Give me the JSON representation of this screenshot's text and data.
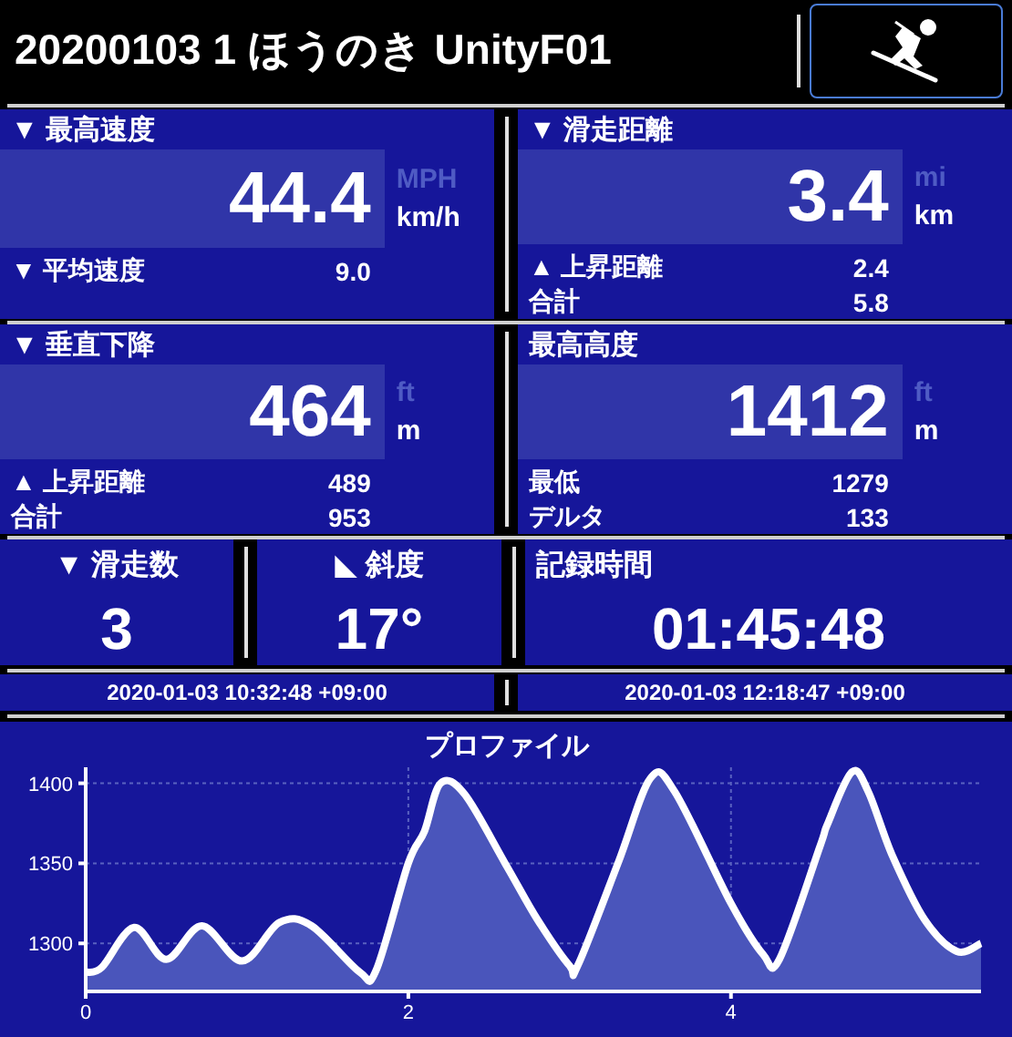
{
  "header": {
    "title": "20200103 1 ほうのき UnityF01"
  },
  "panels": [
    {
      "label": "▼ 最高速度",
      "value": "44.4",
      "units": [
        {
          "label": "MPH",
          "selected": false
        },
        {
          "label": "km/h",
          "selected": true
        }
      ],
      "rows": [
        {
          "label": "▼ 平均速度",
          "value": "9.0"
        }
      ]
    },
    {
      "label": "▼ 滑走距離",
      "value": "3.4",
      "units": [
        {
          "label": "mi",
          "selected": false
        },
        {
          "label": "km",
          "selected": true
        }
      ],
      "rows": [
        {
          "label": "▲ 上昇距離",
          "value": "2.4"
        },
        {
          "label": "合計",
          "value": "5.8"
        }
      ]
    },
    {
      "label": "▼ 垂直下降",
      "value": "464",
      "units": [
        {
          "label": "ft",
          "selected": false
        },
        {
          "label": "m",
          "selected": true
        }
      ],
      "rows": [
        {
          "label": "▲ 上昇距離",
          "value": "489"
        },
        {
          "label": "合計",
          "value": "953"
        }
      ]
    },
    {
      "label": "最高高度",
      "value": "1412",
      "units": [
        {
          "label": "ft",
          "selected": false
        },
        {
          "label": "m",
          "selected": true
        }
      ],
      "rows": [
        {
          "label": "最低",
          "value": "1279"
        },
        {
          "label": "デルタ",
          "value": "133"
        }
      ]
    }
  ],
  "small_panels": [
    {
      "label": "▼ 滑走数",
      "value": "3"
    },
    {
      "label": "◣ 斜度",
      "value": "17°"
    }
  ],
  "duration": {
    "label": "記録時間",
    "value": "01:45:48"
  },
  "times": [
    "2020-01-03 10:32:48 +09:00",
    "2020-01-03 12:18:47 +09:00"
  ],
  "profile": {
    "chart_data": {
      "type": "area",
      "title": "プロファイル",
      "x": [
        0,
        0.1,
        0.3,
        0.5,
        0.72,
        0.97,
        1.2,
        1.4,
        1.7,
        1.8,
        2.0,
        2.1,
        2.2,
        2.35,
        2.6,
        2.8,
        3.0,
        3.05,
        3.3,
        3.5,
        3.65,
        4.0,
        4.2,
        4.3,
        4.55,
        4.6,
        4.75,
        4.85,
        5.0,
        5.2,
        5.4,
        5.55
      ],
      "grid": true,
      "series": [
        {
          "color": "#ffffff",
          "values": [
            1282,
            1285,
            1310,
            1290,
            1311,
            1289,
            1313,
            1311,
            1282,
            1283,
            1350,
            1370,
            1400,
            1393,
            1350,
            1315,
            1286,
            1286,
            1350,
            1403,
            1395,
            1325,
            1293,
            1290,
            1360,
            1375,
            1407,
            1395,
            1355,
            1315,
            1295,
            1300
          ]
        }
      ],
      "xlim": [
        0,
        5.55
      ],
      "ylim": [
        1270,
        1410
      ],
      "xticks": [
        0,
        2,
        4
      ],
      "yticks": [
        1300,
        1350,
        1400
      ]
    }
  }
}
